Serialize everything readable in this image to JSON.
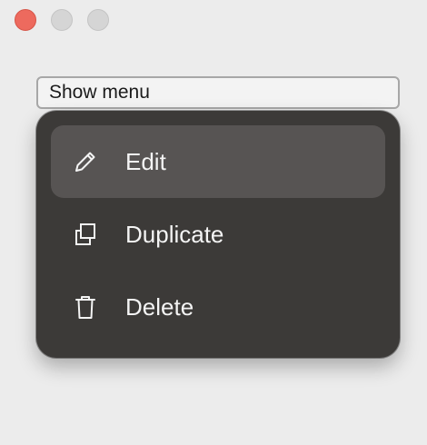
{
  "window": {
    "controls": [
      "close-button",
      "minimize-button",
      "zoom-button"
    ],
    "colors": {
      "close": "#ed6a5e",
      "inactive": "#d5d5d5",
      "background": "#ececec"
    }
  },
  "button": {
    "label": "Show menu"
  },
  "menu": {
    "items": [
      {
        "label": "Edit",
        "icon": "pencil-icon",
        "highlighted": true
      },
      {
        "label": "Duplicate",
        "icon": "duplicate-icon",
        "highlighted": false
      },
      {
        "label": "Delete",
        "icon": "trash-icon",
        "highlighted": false
      }
    ],
    "colors": {
      "background": "#3c3a38",
      "highlight": "#575453",
      "text": "#f4f4f4"
    }
  }
}
